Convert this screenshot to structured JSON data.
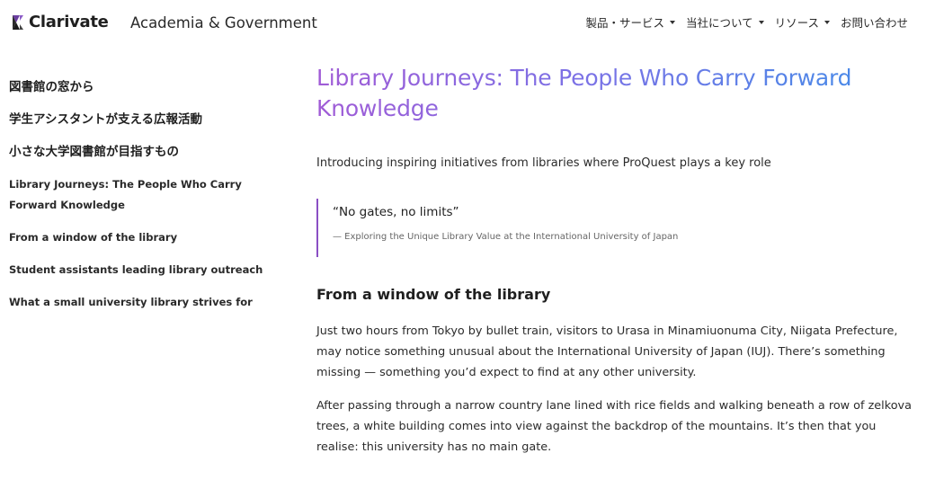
{
  "header": {
    "brand": "Clarivate",
    "division": "Academia & Government",
    "nav": [
      {
        "label": "製品・サービス"
      },
      {
        "label": "当社について"
      },
      {
        "label": "リソース"
      },
      {
        "label": "お問い合わせ"
      }
    ]
  },
  "sidebar": {
    "items": [
      {
        "label": "図書館の窓から"
      },
      {
        "label": "学生アシスタントが支える広報活動"
      },
      {
        "label": "小さな大学図書館が目指すもの"
      },
      {
        "label": "Library Journeys: The People Who Carry Forward Knowledge"
      },
      {
        "label": "From a window of the library"
      },
      {
        "label": "Student assistants leading library outreach"
      },
      {
        "label": "What a small university library strives for"
      }
    ]
  },
  "article": {
    "title": "Library Journeys: The People Who Carry Forward Knowledge",
    "intro": "Introducing inspiring initiatives from libraries where ProQuest plays a key role",
    "quote": {
      "text": "“No gates, no limits”",
      "cite": "— Exploring the Unique Library Value at the International University of Japan"
    },
    "section_heading": "From a window of the library",
    "paragraphs": [
      "Just two hours from Tokyo by bullet train, visitors to Urasa in Minamiuonuma City, Niigata Prefecture, may notice something unusual about the International University of Japan (IUJ). There’s something missing — something you’d expect to find at any other university.",
      "After passing through a narrow country lane lined with rice fields and walking beneath a row of zelkova trees, a white building comes into view against the backdrop of the mountains. It’s then that you realise: this university has no main gate."
    ]
  },
  "colors": {
    "title_gradient_start": "#a05bd6",
    "title_gradient_end": "#3f8ee8",
    "quote_border": "#8a4fc4"
  },
  "icons": {
    "logo": "clarivate-logo-icon",
    "nav_caret": "chevron-down-icon"
  }
}
